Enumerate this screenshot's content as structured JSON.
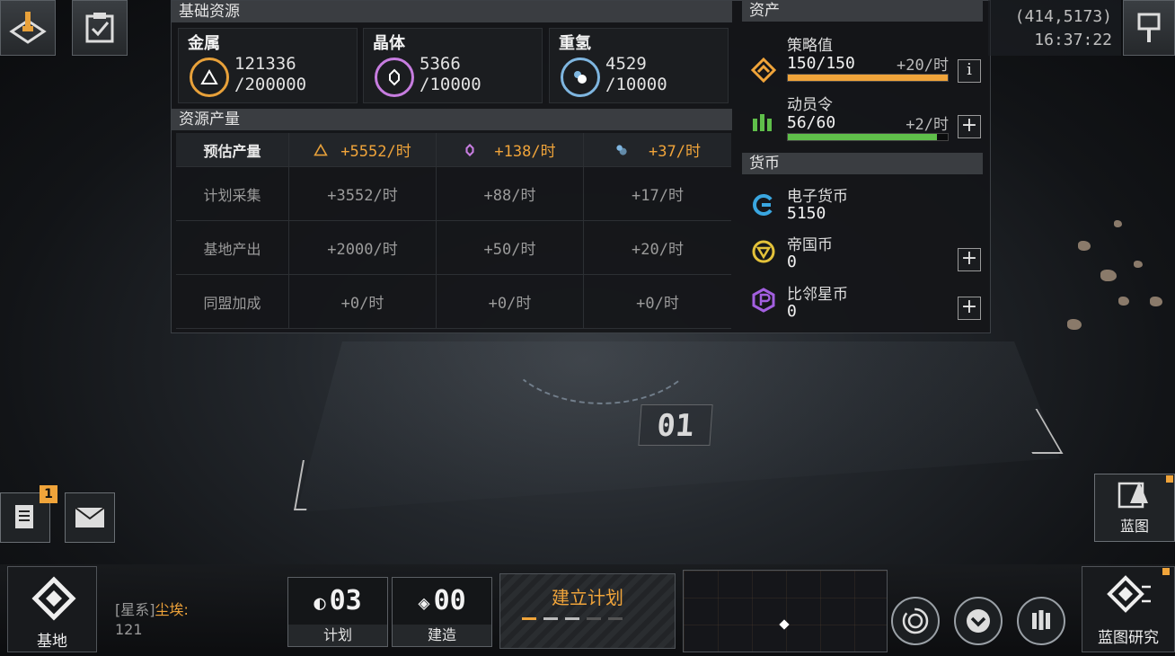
{
  "top_left": {
    "base_icon": "base-build-icon",
    "task_icon": "clipboard-check-icon"
  },
  "base_resources": {
    "header": "基础资源",
    "items": [
      {
        "name": "金属",
        "current": "121336",
        "max": "/200000",
        "color": "#e8a13a"
      },
      {
        "name": "晶体",
        "current": "5366",
        "max": "/10000",
        "color": "#c77de0"
      },
      {
        "name": "重氢",
        "current": "4529",
        "max": "/10000",
        "color": "#7fb6e0"
      }
    ]
  },
  "production": {
    "header": "资源产量",
    "rows": [
      {
        "label": "预估产量",
        "metal": "+5552/时",
        "crystal": "+138/时",
        "deuterium": "+37/时"
      },
      {
        "label": "计划采集",
        "metal": "+3552/时",
        "crystal": "+88/时",
        "deuterium": "+17/时"
      },
      {
        "label": "基地产出",
        "metal": "+2000/时",
        "crystal": "+50/时",
        "deuterium": "+20/时"
      },
      {
        "label": "同盟加成",
        "metal": "+0/时",
        "crystal": "+0/时",
        "deuterium": "+0/时"
      }
    ]
  },
  "assets": {
    "header": "资产",
    "strategy": {
      "label": "策略值",
      "value": "150/150",
      "rate": "+20/时",
      "fill": 1.0,
      "color": "#f0a43a"
    },
    "mobilization": {
      "label": "动员令",
      "value": "56/60",
      "rate": "+2/时",
      "fill": 0.93,
      "color": "#5fbf4a"
    },
    "info_button": "i"
  },
  "currency": {
    "header": "货币",
    "items": [
      {
        "name": "电子货币",
        "value": "5150",
        "icon": "e-currency-icon",
        "has_plus": false
      },
      {
        "name": "帝国币",
        "value": "0",
        "icon": "empire-coin-icon",
        "has_plus": true
      },
      {
        "name": "比邻星币",
        "value": "0",
        "icon": "proxima-coin-icon",
        "has_plus": true
      }
    ]
  },
  "top_right": {
    "coords": "(414,5173)",
    "time": "16:37:22"
  },
  "map": {
    "plate": "01"
  },
  "left_side": {
    "mail_badge": "1"
  },
  "bottom": {
    "base_label": "基地",
    "system_prefix": "[星系]",
    "system_name": "尘埃:",
    "system_id": "121",
    "plan_count": "03",
    "plan_label": "计划",
    "build_count": "00",
    "build_label": "建造",
    "establish_label": "建立计划",
    "blueprint_label": "蓝图",
    "research_label": "蓝图研究"
  }
}
